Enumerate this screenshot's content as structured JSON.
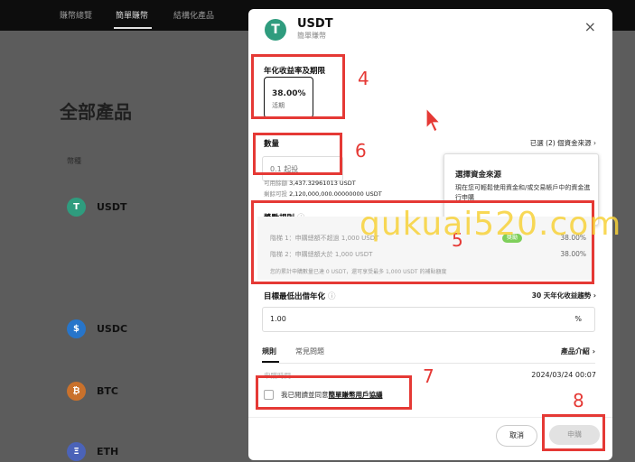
{
  "topnav": {
    "items": [
      "賺幣總覽",
      "簡單賺幣",
      "結構化產品"
    ]
  },
  "background": {
    "page_title": "全部產品",
    "col_header": "幣種",
    "rows": [
      {
        "name": "USDT"
      },
      {
        "name": "USDC"
      },
      {
        "name": "BTC"
      },
      {
        "name": "ETH"
      }
    ]
  },
  "modal": {
    "coin": "USDT",
    "product": "簡單賺幣",
    "close_icon": "×",
    "apy_label": "年化收益率及期限",
    "apy_value": "38.00%",
    "apy_term": "活期",
    "qty_label": "數量",
    "qty_link": "已選 (2) 個資金來源",
    "qty_placeholder": "0.1 起投",
    "available_label": "可用餘額",
    "available_value": "3,437.32961013 USDT",
    "limit_label": "剩餘可投",
    "limit_value": "2,120,000,000.00000000 USDT",
    "tooltip_title": "選擇資金來源",
    "tooltip_body": "現在您可輕鬆使用資金和/或交易帳戶中的資金進行申購",
    "promo_label": "獎勵規則",
    "promo_tier1": "階梯 1：申購總額不超過 1,000 USDT",
    "promo_tier1_tag": "獎勵",
    "promo_tier1_pct": "38.00%",
    "promo_tier2": "階梯 2：申購總額大於 1,000 USDT",
    "promo_tier2_pct": "38.00%",
    "promo_note": "您的累計申購數量已達 0 USDT，還可享受最多 1,000 USDT 的補貼額度",
    "min_apy_label": "目標最低出借年化",
    "min_apy_link": "30 天年化收益趨勢",
    "min_apy_value": "1.00",
    "min_apy_unit": "%",
    "tab_rules": "規則",
    "tab_faq": "常見問題",
    "product_intro": "產品介紹",
    "subscribe_time_label": "申購時間",
    "subscribe_time": "2024/03/24 00:07",
    "agree_prefix": "我已閱讀並同意",
    "agree_link": "簡單賺幣用戶協議",
    "cancel": "取消",
    "apply": "申購"
  },
  "annotations": [
    "4",
    "6",
    "5",
    "7",
    "8"
  ],
  "watermark": "qukuai520.com",
  "colors": {
    "annotation": "#e53935",
    "usdt": "#2f9c7e",
    "watermark": "#f7d138"
  }
}
